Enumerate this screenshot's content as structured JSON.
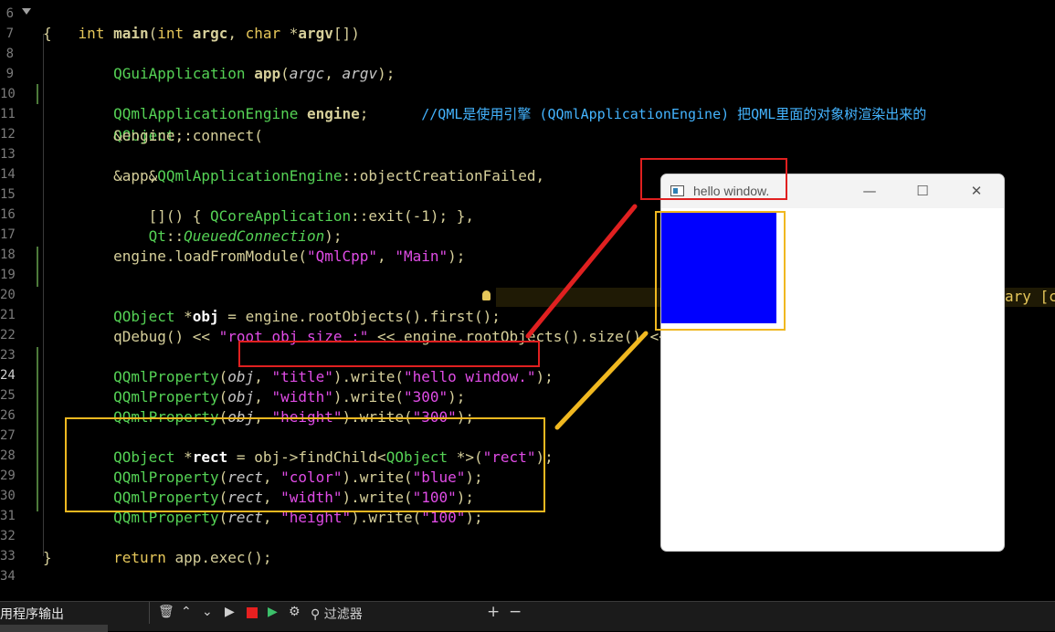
{
  "editor": {
    "line_numbers": [
      "6",
      "7",
      "8",
      "9",
      "10",
      "11",
      "12",
      "13",
      "14",
      "15",
      "16",
      "17",
      "18",
      "19",
      "20",
      "21",
      "22",
      "23",
      "24",
      "25",
      "26",
      "27",
      "28",
      "29",
      "30",
      "31",
      "32",
      "33",
      "34"
    ],
    "lines": {
      "l6": [
        "int",
        " ",
        "main",
        "(",
        "int",
        " ",
        "argc",
        ", ",
        "char",
        " *",
        "argv",
        "[])"
      ],
      "l7": "{",
      "l8": [
        "    ",
        "QGuiApplication",
        " ",
        "app",
        "(",
        "argc",
        ", ",
        "argv",
        ");"
      ],
      "l10": [
        "    ",
        "QQmlApplicationEngine",
        " ",
        "engine",
        ";",
        "      ",
        "//QML是使用引擎 (QQmlApplicationEngine) 把QML里面的对象树渲染出来的"
      ],
      "l11": [
        "    ",
        "QObject",
        "::connect("
      ],
      "l12": "        &engine,",
      "l13": [
        "        &",
        "QQmlApplicationEngine",
        "::objectCreationFailed,"
      ],
      "l14": "        &app,",
      "l15": [
        "        []() { ",
        "QCoreApplication",
        "::exit(-1); },"
      ],
      "l16": [
        "        ",
        "Qt",
        "::",
        "QueuedConnection",
        ");"
      ],
      "l17": [
        "    engine.loadFromModule(",
        "\"QmlCpp\"",
        ", ",
        "\"Main\"",
        ");"
      ],
      "l20": [
        "    ",
        "QObject",
        " *",
        "obj",
        " = engine.rootObjects().first();"
      ],
      "l20_tail": "ary [c",
      "l21": [
        "    qDebug() << ",
        "\"root obj size :\"",
        " << engine.rootObjects().size() <<"
      ],
      "l23": [
        "    ",
        "QQmlProperty",
        "(",
        "obj",
        ", ",
        "\"title\"",
        ").write(",
        "\"hello window.\"",
        ");"
      ],
      "l24": [
        "    ",
        "QQmlProperty",
        "(",
        "obj",
        ", ",
        "\"width\"",
        ").write(",
        "\"300\"",
        ");"
      ],
      "l25": [
        "    ",
        "QQmlProperty",
        "(",
        "obj",
        ", ",
        "\"height\"",
        ").write(",
        "\"300\"",
        ");"
      ],
      "l27": [
        "    ",
        "QObject",
        " *",
        "rect",
        " = obj->findChild<",
        "QObject",
        " *>(",
        "\"rect\"",
        ");"
      ],
      "l28": [
        "    ",
        "QQmlProperty",
        "(",
        "rect",
        ", ",
        "\"color\"",
        ").write(",
        "\"blue\"",
        ");"
      ],
      "l29": [
        "    ",
        "QQmlProperty",
        "(",
        "rect",
        ", ",
        "\"width\"",
        ").write(",
        "\"100\"",
        ");"
      ],
      "l30": [
        "    ",
        "QQmlProperty",
        "(",
        "rect",
        ", ",
        "\"height\"",
        ").write(",
        "\"100\"",
        ");"
      ],
      "l32": [
        "    ",
        "return",
        " app.exec();"
      ],
      "l33": "}"
    }
  },
  "qml_window": {
    "title": "hello window.",
    "minimize_glyph": "—",
    "maximize_glyph": "☐",
    "close_glyph": "✕",
    "rect_color": "#0000ff"
  },
  "statusbar": {
    "panel_label": "用程序输出",
    "filter_label": "过滤器",
    "plus": "+",
    "minus": "−"
  },
  "colors": {
    "annotation_red": "#e02020",
    "annotation_yellow": "#f0b820",
    "string": "#e04ce6",
    "class": "#55d255",
    "comment": "#44b4ff",
    "keyword": "#e6c75a"
  }
}
